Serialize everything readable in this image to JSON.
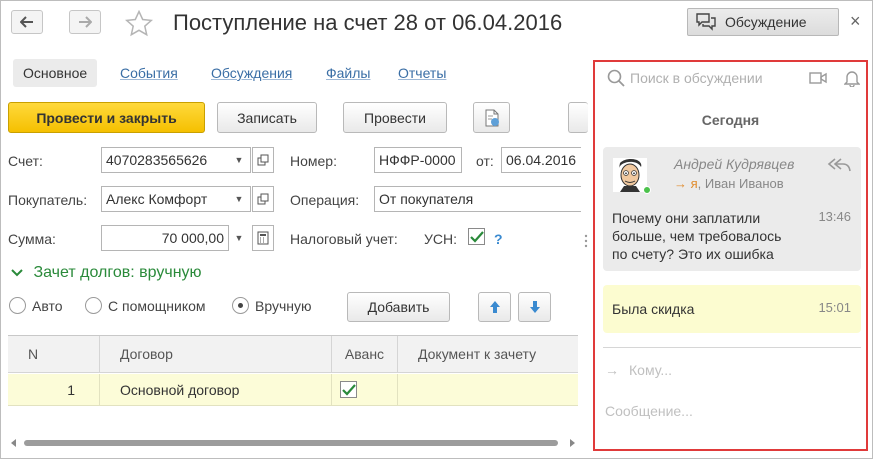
{
  "window": {
    "title": "Поступление на счет 28 от 06.04.2016",
    "discussion_toggle": "Обсуждение",
    "close": "×"
  },
  "tabs": [
    {
      "label": "Основное"
    },
    {
      "label": "События"
    },
    {
      "label": "Обсуждения"
    },
    {
      "label": "Файлы"
    },
    {
      "label": "Отчеты"
    }
  ],
  "toolbar": {
    "post_close": "Провести и закрыть",
    "save": "Записать",
    "post": "Провести"
  },
  "form": {
    "account_label": "Счет:",
    "account_value": "4070283565626",
    "number_label": "Номер:",
    "number_value": "НФФР-0000",
    "date_label": "от:",
    "date_value": "06.04.2016",
    "buyer_label": "Покупатель:",
    "buyer_value": "Алекс Комфорт",
    "operation_label": "Операция:",
    "operation_value": "От покупателя",
    "sum_label": "Сумма:",
    "sum_value": "70 000,00",
    "tax_label": "Налоговый учет:",
    "usn_label": "УСН:",
    "help": "?"
  },
  "debts": {
    "title": "Зачет долгов: вручную",
    "radio_auto": "Авто",
    "radio_helper": "С помощником",
    "radio_manual": "Вручную",
    "add_button": "Добавить"
  },
  "table": {
    "headers": [
      "N",
      "Договор",
      "Аванс",
      "Документ к зачету"
    ],
    "rows": [
      {
        "n": "1",
        "contract": "Основной договор",
        "advance": true,
        "doc": ""
      }
    ]
  },
  "discussion": {
    "search_placeholder": "Поиск в обсуждении",
    "day_header": "Сегодня",
    "message1": {
      "author": "Андрей Кудрявцев",
      "recipient_arrow": "→",
      "recipient_me": "я",
      "recipient_rest": ", Иван Иванов",
      "text_lines": [
        "Почему они заплатили",
        "больше, чем требовалось",
        "по счету? Это их ошибка"
      ],
      "time": "13:46"
    },
    "message2": {
      "text": "Была скидка",
      "time": "15:01"
    },
    "to_arrow": "→",
    "to_placeholder": "Кому...",
    "message_placeholder": "Сообщение..."
  },
  "colors": {
    "primary_button": "#f5c000",
    "section_green": "#2a8a3a",
    "link_blue": "#3a6ea5",
    "panel_border": "#e03a3a",
    "selected_row": "#fcfcd8",
    "own_message": "#fcfcd0"
  }
}
